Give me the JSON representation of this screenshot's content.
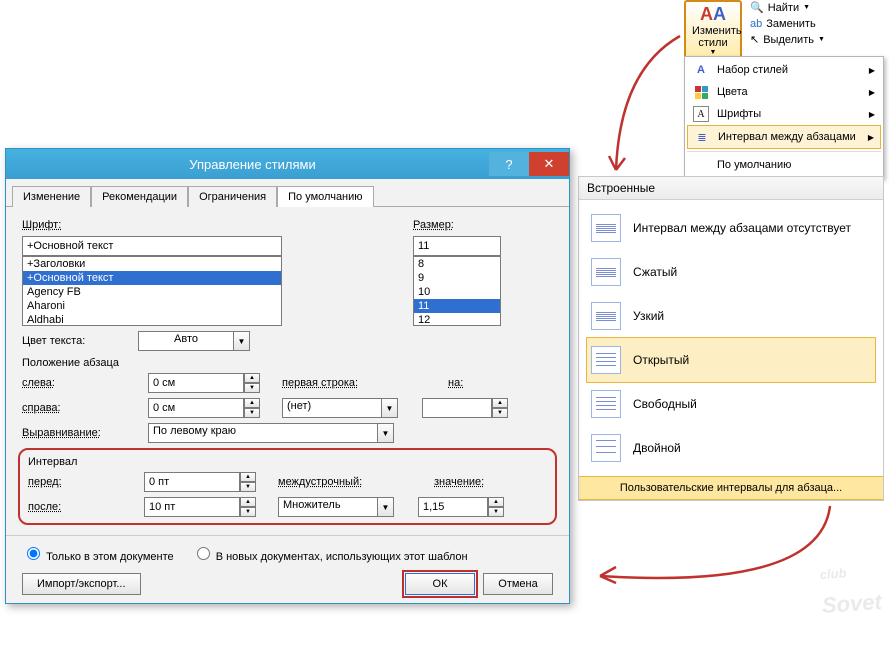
{
  "ribbon": {
    "changeStyles": {
      "label": "Изменить стили",
      "iconText": "A",
      "iconText2": "A"
    },
    "find": "Найти",
    "replace": "Заменить",
    "select": "Выделить"
  },
  "dropdown": {
    "items": [
      {
        "label": "Набор стилей"
      },
      {
        "label": "Цвета"
      },
      {
        "label": "Шрифты"
      },
      {
        "label": "Интервал между абзацами",
        "highlight": true
      },
      {
        "label": "По умолчанию"
      }
    ]
  },
  "builtin": {
    "header": "Встроенные",
    "options": [
      {
        "label": "Интервал между абзацами отсутствует",
        "gap": 0
      },
      {
        "label": "Сжатый",
        "gap": 0
      },
      {
        "label": "Узкий",
        "gap": 0
      },
      {
        "label": "Открытый",
        "gap": 3,
        "selected": true
      },
      {
        "label": "Свободный",
        "gap": 3
      },
      {
        "label": "Двойной",
        "gap": 5
      }
    ],
    "footer": "Пользовательские интервалы для абзаца..."
  },
  "dialog": {
    "title": "Управление стилями",
    "tabs": [
      "Изменение",
      "Рекомендации",
      "Ограничения",
      "По умолчанию"
    ],
    "activeTab": 3,
    "font": {
      "label": "Шрифт:",
      "value": "+Основной текст",
      "list": [
        "+Заголовки",
        "+Основной текст",
        "Agency FB",
        "Aharoni",
        "Aldhabi"
      ],
      "selected": "+Основной текст"
    },
    "size": {
      "label": "Размер:",
      "value": "11",
      "list": [
        "8",
        "9",
        "10",
        "11",
        "12"
      ],
      "selected": "11"
    },
    "textColor": {
      "label": "Цвет текста:",
      "value": "Авто"
    },
    "paraPos": "Положение абзаца",
    "left": {
      "label": "слева:",
      "value": "0 см"
    },
    "firstLine": {
      "label": "первая строка:",
      "by": "на:"
    },
    "right": {
      "label": "справа:",
      "value": "0 см",
      "line": "(нет)"
    },
    "align": {
      "label": "Выравнивание:",
      "value": "По левому краю"
    },
    "interval": {
      "title": "Интервал",
      "before": {
        "label": "перед:",
        "value": "0 пт"
      },
      "after": {
        "label": "после:",
        "value": "10 пт"
      },
      "lineSpacing": {
        "label": "междустрочный:",
        "value": "Множитель"
      },
      "valueLbl": "значение:",
      "valueNum": "1,15"
    },
    "radios": {
      "thisDoc": "Только в этом документе",
      "newDocs": "В новых документах, использующих этот шаблон"
    },
    "importExport": "Импорт/экспорт...",
    "ok": "ОК",
    "cancel": "Отмена"
  },
  "watermark": "Sovet"
}
